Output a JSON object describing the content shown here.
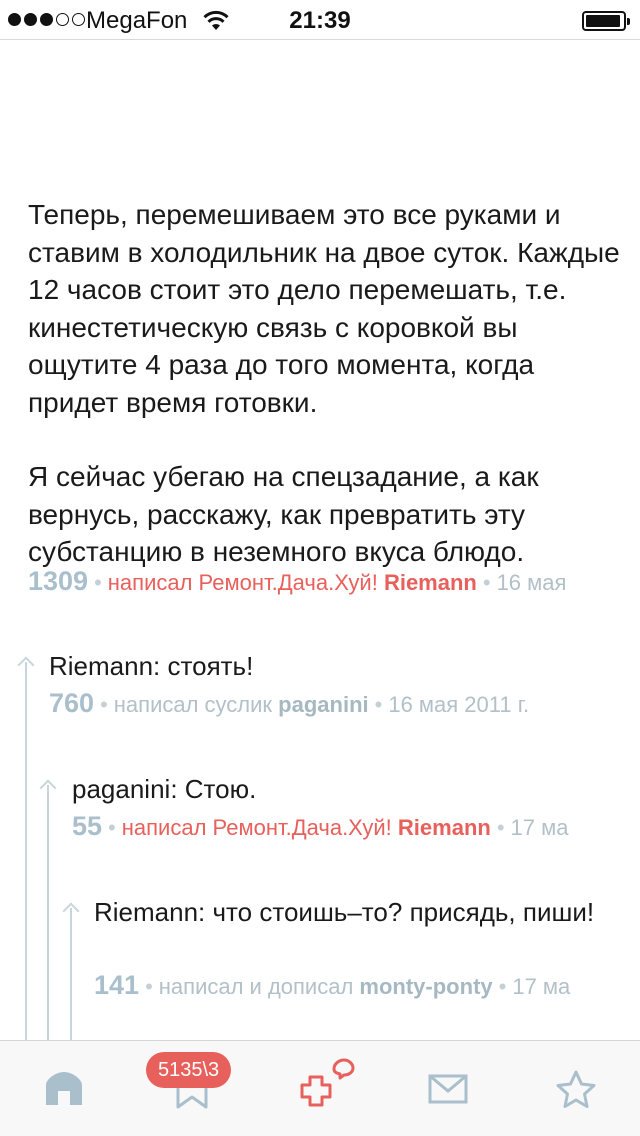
{
  "status_bar": {
    "carrier": "MegaFon",
    "time": "21:39",
    "signal_bars_filled": 3,
    "signal_bars_total": 5
  },
  "post": {
    "paragraphs": [
      "Теперь, перемешиваем это все руками и ставим в холодильник на двое суток. Каждые 12 часов стоит это дело переме­шать, т.е. кинестетическую связь с коров­кой вы ощутите 4 раза до того момента, когда придет время готовки.",
      "Я сейчас убегаю на спецзадание, а как вернусь, расскажу, как превратить эту субстанцию в неземного вкуса блюдо."
    ],
    "score": "1309",
    "written_by": "написал Ремонт.Дача.Хуй!",
    "author": "Riemann",
    "date": "16 мая"
  },
  "comments": [
    {
      "text": "Riemann: стоять!",
      "score": "760",
      "written_by": "написал суслик",
      "author": "paganini",
      "date": "16 мая 2011 г."
    },
    {
      "text": "paganini: Стою.",
      "score": "55",
      "written_by": "написал Ремонт.Дача.Хуй!",
      "author": "Riemann",
      "date": "17 ма"
    },
    {
      "text": "Riemann: что стоишь–то? присядь, пиши!",
      "score": "141",
      "written_by": "написал и дописал",
      "author": "monty-ponty",
      "date": "17 ма"
    }
  ],
  "tabbar": {
    "tabs": [
      "home-icon",
      "bookmark-icon",
      "add-post-icon",
      "mail-icon",
      "star-icon"
    ],
    "badge": "5135\\3"
  },
  "colors": {
    "accent": "#e8605b",
    "meta": "#a6b8c2",
    "thread": "#c8d5dc",
    "icon_inactive": "#a9bfcc"
  },
  "separator": "•"
}
